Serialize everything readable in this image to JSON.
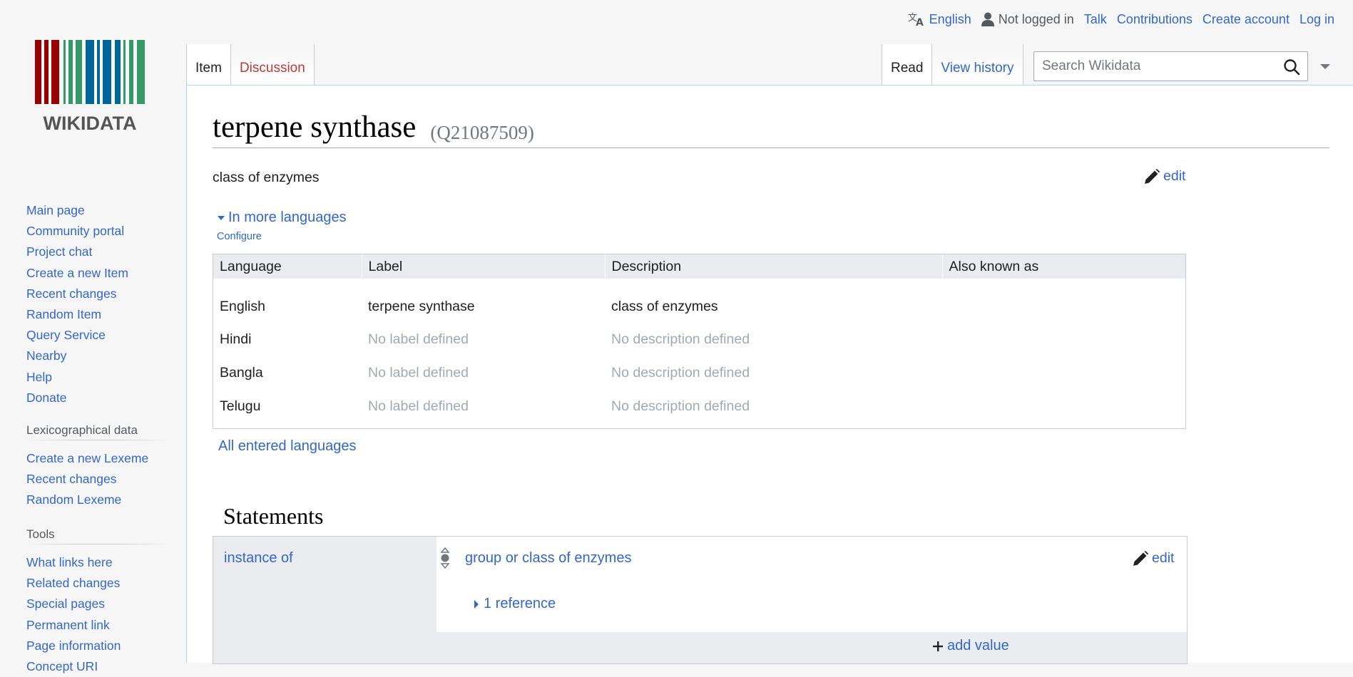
{
  "personal_bar": {
    "language": "English",
    "user_status": "Not logged in",
    "talk": "Talk",
    "contributions": "Contributions",
    "create_account": "Create account",
    "log_in": "Log in"
  },
  "logo_text": "WIKIDATA",
  "sidebar": {
    "navigation": [
      "Main page",
      "Community portal",
      "Project chat",
      "Create a new Item",
      "Recent changes",
      "Random Item",
      "Query Service",
      "Nearby",
      "Help",
      "Donate"
    ],
    "lexicographical": {
      "heading": "Lexicographical data",
      "items": [
        "Create a new Lexeme",
        "Recent changes",
        "Random Lexeme"
      ]
    },
    "tools": {
      "heading": "Tools",
      "items": [
        "What links here",
        "Related changes",
        "Special pages",
        "Permanent link",
        "Page information",
        "Concept URI"
      ]
    }
  },
  "tabs": {
    "item": "Item",
    "discussion": "Discussion",
    "read": "Read",
    "view_history": "View history"
  },
  "search": {
    "placeholder": "Search Wikidata"
  },
  "entity": {
    "label": "terpene synthase",
    "id": "(Q21087509)",
    "description": "class of enzymes",
    "edit": "edit"
  },
  "languages": {
    "toggle": "In more languages",
    "configure": "Configure",
    "headers": [
      "Language",
      "Label",
      "Description",
      "Also known as"
    ],
    "rows": [
      {
        "language": "English",
        "label": "terpene synthase",
        "description": "class of enzymes",
        "aliases": "",
        "label_empty": false,
        "desc_empty": false
      },
      {
        "language": "Hindi",
        "label": "No label defined",
        "description": "No description defined",
        "aliases": "",
        "label_empty": true,
        "desc_empty": true
      },
      {
        "language": "Bangla",
        "label": "No label defined",
        "description": "No description defined",
        "aliases": "",
        "label_empty": true,
        "desc_empty": true
      },
      {
        "language": "Telugu",
        "label": "No label defined",
        "description": "No description defined",
        "aliases": "",
        "label_empty": true,
        "desc_empty": true
      }
    ],
    "all_entered": "All entered languages"
  },
  "statements": {
    "heading": "Statements",
    "group": {
      "property": "instance of",
      "value": "group or class of enzymes",
      "edit": "edit",
      "references": "1 reference",
      "add_value": "add value"
    }
  },
  "colors": {
    "link": "#3366cc",
    "new_link": "#ba3b37",
    "muted": "#a2a9b1",
    "tab_border": "#a7d7f9"
  }
}
